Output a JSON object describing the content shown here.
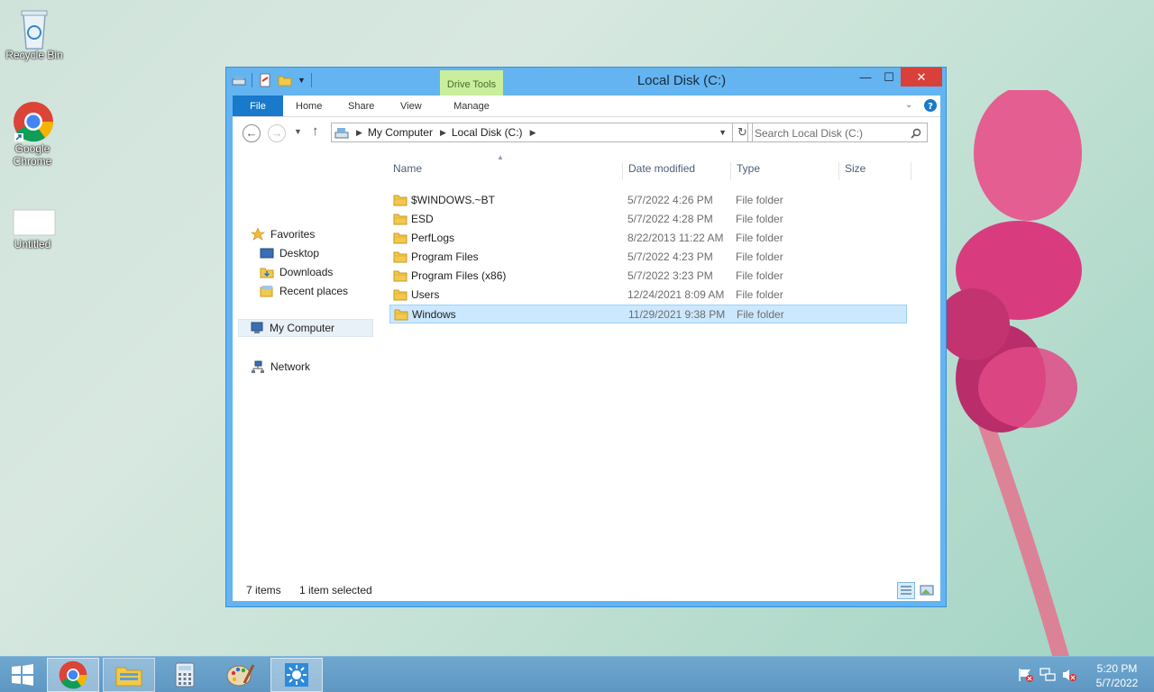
{
  "desktop": {
    "icons": [
      {
        "label": "Recycle Bin"
      },
      {
        "label": "Google Chrome"
      },
      {
        "label": "Untitled"
      }
    ]
  },
  "window": {
    "title": "Local Disk (C:)",
    "context_tab": "Drive Tools",
    "controls": {
      "minimize": "—",
      "maximize": "☐",
      "close": "✕"
    },
    "ribbon_tabs": [
      "File",
      "Home",
      "Share",
      "View",
      "Manage"
    ],
    "address": {
      "parts": [
        "My Computer",
        "Local Disk (C:)"
      ]
    },
    "search_placeholder": "Search Local Disk (C:)",
    "nav": {
      "favorites": "Favorites",
      "desktop": "Desktop",
      "downloads": "Downloads",
      "recent": "Recent places",
      "my_computer": "My Computer",
      "network": "Network"
    },
    "columns": [
      "Name",
      "Date modified",
      "Type",
      "Size"
    ],
    "files": [
      {
        "name": "$WINDOWS.~BT",
        "date": "5/7/2022 4:26 PM",
        "type": "File folder",
        "selected": false
      },
      {
        "name": "ESD",
        "date": "5/7/2022 4:28 PM",
        "type": "File folder",
        "selected": false
      },
      {
        "name": "PerfLogs",
        "date": "8/22/2013 11:22 AM",
        "type": "File folder",
        "selected": false
      },
      {
        "name": "Program Files",
        "date": "5/7/2022 4:23 PM",
        "type": "File folder",
        "selected": false
      },
      {
        "name": "Program Files (x86)",
        "date": "5/7/2022 3:23 PM",
        "type": "File folder",
        "selected": false
      },
      {
        "name": "Users",
        "date": "12/24/2021 8:09 AM",
        "type": "File folder",
        "selected": false
      },
      {
        "name": "Windows",
        "date": "11/29/2021 9:38 PM",
        "type": "File folder",
        "selected": true
      }
    ],
    "status": {
      "items": "7 items",
      "selected": "1 item selected"
    }
  },
  "taskbar": {
    "clock_time": "5:20 PM",
    "clock_date": "5/7/2022"
  },
  "colors": {
    "window_frame": "#63b4f0",
    "file_tab": "#1979ca",
    "close_button": "#d9403a",
    "drive_tools": "#c9ee9c",
    "selection": "#cce8ff"
  }
}
